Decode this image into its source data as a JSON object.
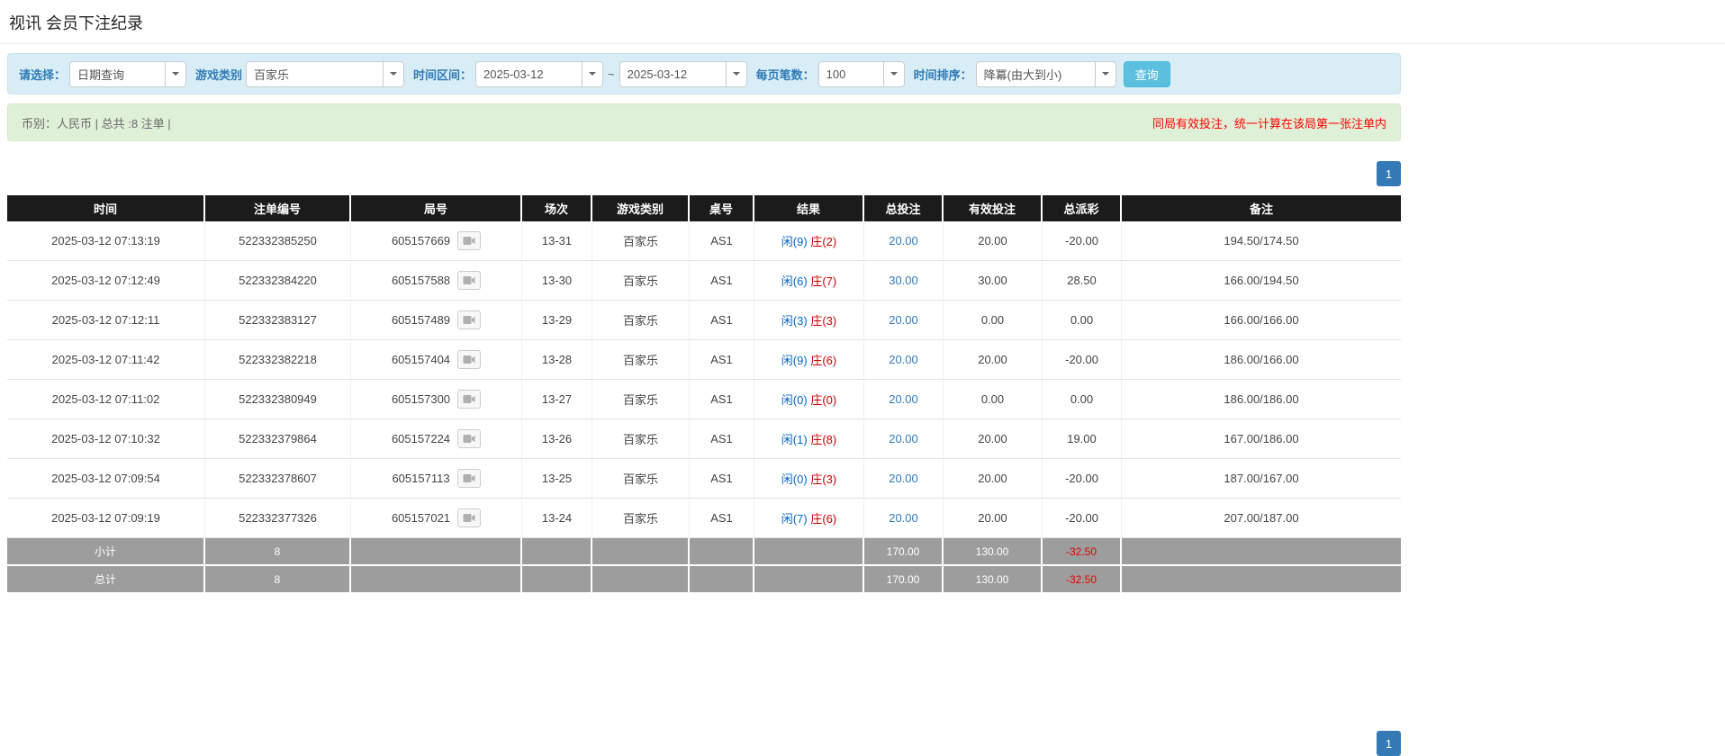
{
  "page": {
    "title": "视讯 会员下注纪录"
  },
  "filter_bar": {
    "select_label": "请选择：",
    "select_value": "日期查询",
    "game_label": "游戏类别",
    "game_value": "百家乐",
    "range_label": "时间区间：",
    "date_from": "2025-03-12",
    "range_separator": "~",
    "date_to": "2025-03-12",
    "per_page_label": "每页笔数：",
    "per_page_value": "100",
    "sort_label": "时间排序：",
    "sort_value": "降冪(由大到小)",
    "search_button": "查询"
  },
  "summary_bar": {
    "info": "币别：人民币 | 总共 :8 注单 |",
    "notice": "同局有效投注，统一计算在该局第一张注单内"
  },
  "pagination": {
    "current_page": "1"
  },
  "table": {
    "headers": [
      "时间",
      "注单编号",
      "局号",
      "场次",
      "游戏类别",
      "桌号",
      "结果",
      "总投注",
      "有效投注",
      "总派彩",
      "备注"
    ],
    "rows": [
      {
        "time": "2025-03-12 07:13:19",
        "bet_id": "522332385250",
        "round_id": "605157669",
        "session": "13-31",
        "game": "百家乐",
        "table_no": "AS1",
        "result_player": "闲(9)",
        "result_banker": "庄(2)",
        "total_bet": "20.00",
        "valid_bet": "20.00",
        "payout": "-20.00",
        "remark": "194.50/174.50"
      },
      {
        "time": "2025-03-12 07:12:49",
        "bet_id": "522332384220",
        "round_id": "605157588",
        "session": "13-30",
        "game": "百家乐",
        "table_no": "AS1",
        "result_player": "闲(6)",
        "result_banker": "庄(7)",
        "total_bet": "30.00",
        "valid_bet": "30.00",
        "payout": "28.50",
        "remark": "166.00/194.50"
      },
      {
        "time": "2025-03-12 07:12:11",
        "bet_id": "522332383127",
        "round_id": "605157489",
        "session": "13-29",
        "game": "百家乐",
        "table_no": "AS1",
        "result_player": "闲(3)",
        "result_banker": "庄(3)",
        "total_bet": "20.00",
        "valid_bet": "0.00",
        "payout": "0.00",
        "remark": "166.00/166.00"
      },
      {
        "time": "2025-03-12 07:11:42",
        "bet_id": "522332382218",
        "round_id": "605157404",
        "session": "13-28",
        "game": "百家乐",
        "table_no": "AS1",
        "result_player": "闲(9)",
        "result_banker": "庄(6)",
        "total_bet": "20.00",
        "valid_bet": "20.00",
        "payout": "-20.00",
        "remark": "186.00/166.00"
      },
      {
        "time": "2025-03-12 07:11:02",
        "bet_id": "522332380949",
        "round_id": "605157300",
        "session": "13-27",
        "game": "百家乐",
        "table_no": "AS1",
        "result_player": "闲(0)",
        "result_banker": "庄(0)",
        "total_bet": "20.00",
        "valid_bet": "0.00",
        "payout": "0.00",
        "remark": "186.00/186.00"
      },
      {
        "time": "2025-03-12 07:10:32",
        "bet_id": "522332379864",
        "round_id": "605157224",
        "session": "13-26",
        "game": "百家乐",
        "table_no": "AS1",
        "result_player": "闲(1)",
        "result_banker": "庄(8)",
        "total_bet": "20.00",
        "valid_bet": "20.00",
        "payout": "19.00",
        "remark": "167.00/186.00"
      },
      {
        "time": "2025-03-12 07:09:54",
        "bet_id": "522332378607",
        "round_id": "605157113",
        "session": "13-25",
        "game": "百家乐",
        "table_no": "AS1",
        "result_player": "闲(0)",
        "result_banker": "庄(3)",
        "total_bet": "20.00",
        "valid_bet": "20.00",
        "payout": "-20.00",
        "remark": "187.00/167.00"
      },
      {
        "time": "2025-03-12 07:09:19",
        "bet_id": "522332377326",
        "round_id": "605157021",
        "session": "13-24",
        "game": "百家乐",
        "table_no": "AS1",
        "result_player": "闲(7)",
        "result_banker": "庄(6)",
        "total_bet": "20.00",
        "valid_bet": "20.00",
        "payout": "-20.00",
        "remark": "207.00/187.00"
      }
    ],
    "footer_rows": [
      {
        "label": "小计",
        "count": "8",
        "total_bet": "170.00",
        "valid_bet": "130.00",
        "payout": "-32.50"
      },
      {
        "label": "总计",
        "count": "8",
        "total_bet": "170.00",
        "valid_bet": "130.00",
        "payout": "-32.50"
      }
    ]
  },
  "icons": {
    "dropdown": "chevron-down-icon",
    "round_replay": "video-icon"
  },
  "colors": {
    "accent_blue": "#337ab7",
    "search_button_blue": "#5bc0de",
    "filter_bar_bg": "#d9edf7",
    "summary_bar_bg": "#dff0d8",
    "notice_red": "#ff0000",
    "player_blue": "#0066cc",
    "banker_red": "#cc0000",
    "negative_red": "#e60000",
    "table_header_bg": "#1b1b1b",
    "table_footer_bg": "#9d9d9d"
  }
}
